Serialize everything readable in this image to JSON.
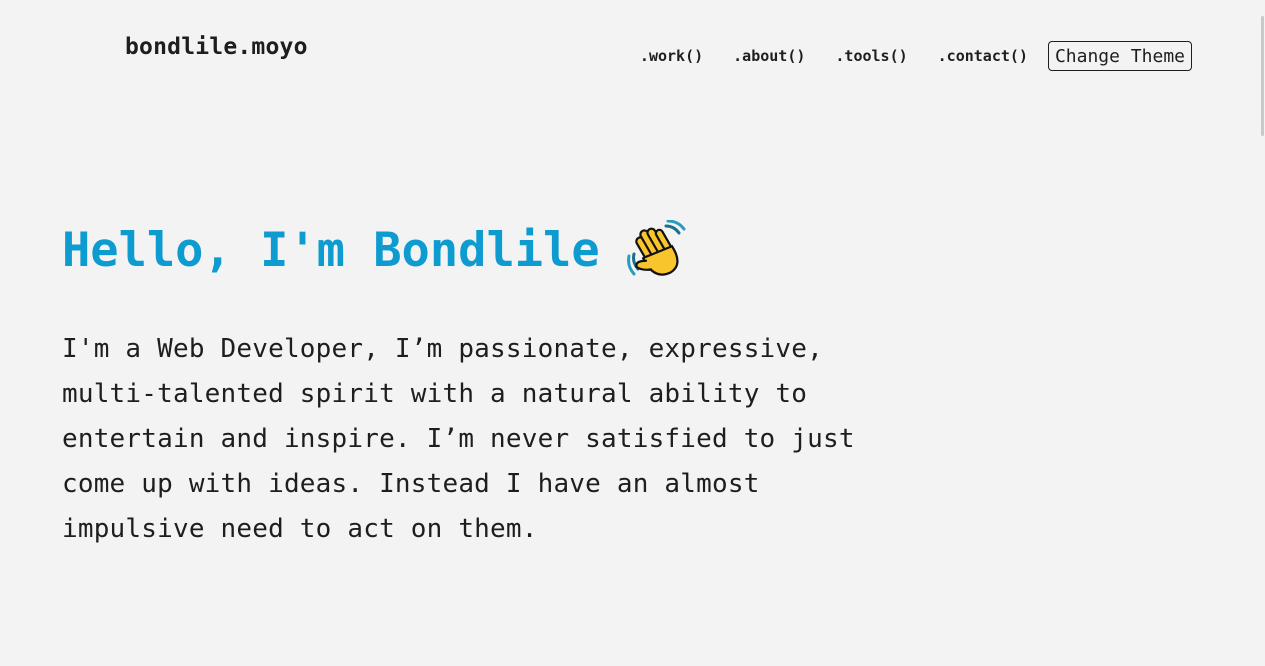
{
  "header": {
    "logo": "bondlile.moyo",
    "nav": [
      {
        "label": ".work()"
      },
      {
        "label": ".about()"
      },
      {
        "label": ".tools()"
      },
      {
        "label": ".contact()"
      }
    ],
    "theme_button": "Change Theme"
  },
  "hero": {
    "title": "Hello, I'm Bondlile",
    "emoji": "waving-hand-icon",
    "description": "I'm a Web Developer, I’m passionate, expressive, multi-talented spirit with a natural ability to entertain and inspire. I’m never satisfied to just come up with ideas. Instead I have an almost impulsive need to act on them."
  },
  "colors": {
    "accent": "#0e9bd0",
    "background": "#f3f3f3",
    "text": "#1e1e1e"
  }
}
